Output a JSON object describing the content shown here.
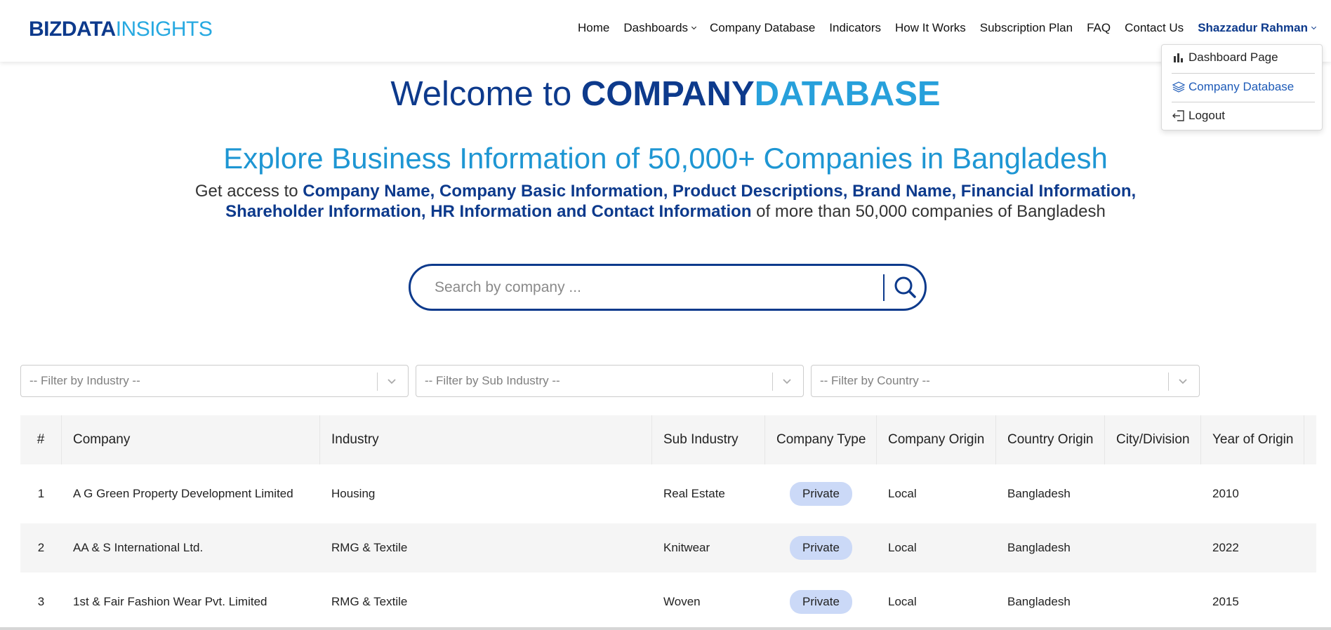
{
  "brand": {
    "bold": "BIZDATA",
    "light": "INSIGHTS"
  },
  "nav": {
    "home": "Home",
    "dashboards": "Dashboards",
    "company_database": "Company Database",
    "indicators": "Indicators",
    "how_it_works": "How It Works",
    "subscription_plan": "Subscription Plan",
    "faq": "FAQ",
    "contact_us": "Contact Us",
    "user": "Shazzadur Rahman"
  },
  "user_menu": {
    "items": [
      {
        "label": "Dashboard Page",
        "icon": "bar-chart-icon"
      },
      {
        "label": "Company Database",
        "icon": "layers-icon"
      },
      {
        "label": "Logout",
        "icon": "logout-icon"
      }
    ]
  },
  "hero": {
    "welcome_prefix": "Welcome to ",
    "welcome_bold1": "COMPANY",
    "welcome_bold2": "DATABASE",
    "explore": "Explore Business Information of 50,000+ Companies in Bangladesh",
    "access_prefix": "Get access to ",
    "access_highlight": "Company Name, Company Basic Information, Product Descriptions, Brand Name, Financial Information, Shareholder Information, HR Information and Contact Information",
    "access_suffix": " of more than 50,000 companies of Bangladesh"
  },
  "search": {
    "placeholder": "Search by company ...",
    "value": ""
  },
  "filters": {
    "industry": "-- Filter by Industry --",
    "sub_industry": "-- Filter by Sub Industry --",
    "country": "-- Filter by Country --"
  },
  "table": {
    "headers": [
      "#",
      "Company",
      "Industry",
      "Sub Industry",
      "Company Type",
      "Company Origin",
      "Country Origin",
      "City/Division",
      "Year of Origin"
    ],
    "rows": [
      [
        "1",
        "A G Green Property Development Limited",
        "Housing",
        "Real Estate",
        "Private",
        "Local",
        "Bangladesh",
        "",
        "2010"
      ],
      [
        "2",
        "AA & S International Ltd.",
        "RMG & Textile",
        "Knitwear",
        "Private",
        "Local",
        "Bangladesh",
        "",
        "2022"
      ],
      [
        "3",
        "1st & Fair Fashion Wear Pvt. Limited",
        "RMG & Textile",
        "Woven",
        "Private",
        "Local",
        "Bangladesh",
        "",
        "2015"
      ]
    ]
  },
  "colors": {
    "brand_dark": "#0d3a8c",
    "brand_light": "#27a9e1",
    "badge": "#cbd9f7"
  }
}
